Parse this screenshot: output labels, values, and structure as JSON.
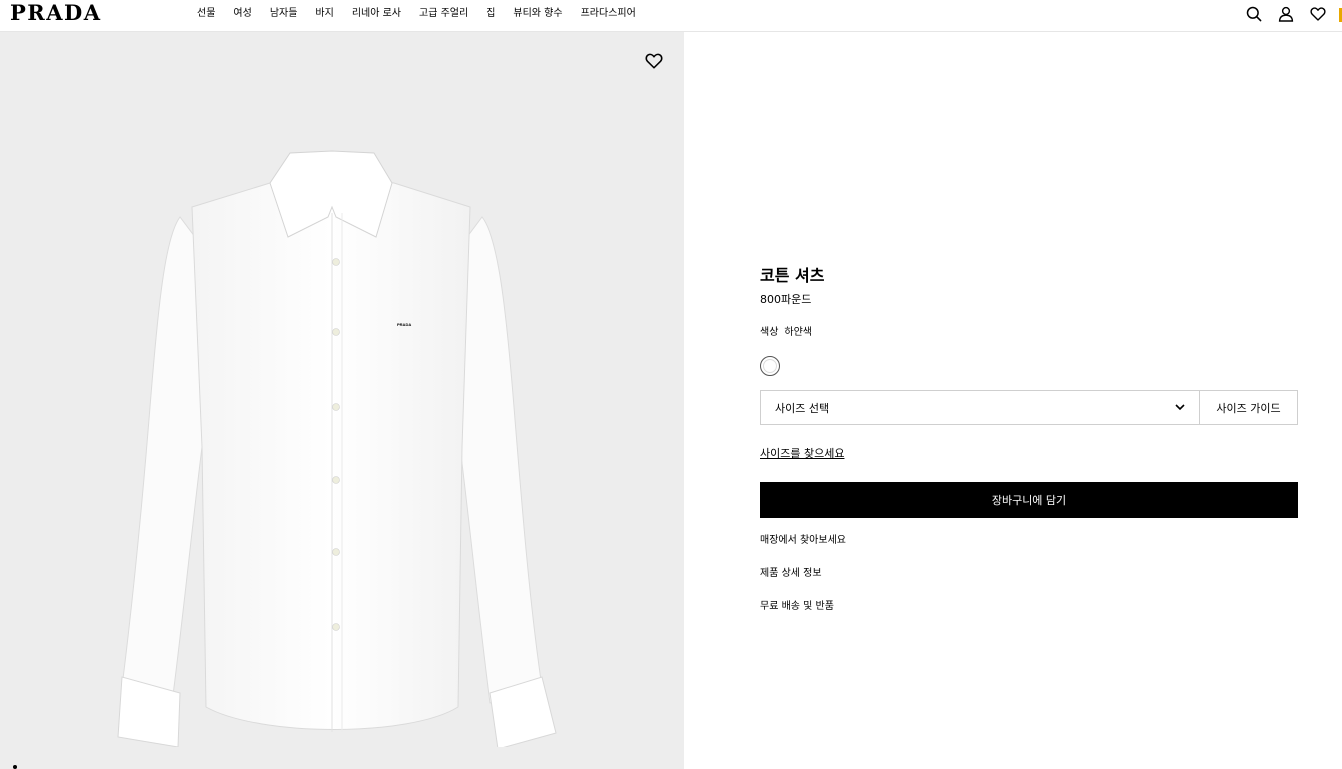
{
  "brand": {
    "logo": "PRADA"
  },
  "nav": {
    "items": [
      "선물",
      "여성",
      "남자들",
      "바지",
      "리네아 로사",
      "고급 주얼리",
      "집",
      "뷰티와 향수",
      "프라다스피어"
    ]
  },
  "header_icons": [
    "search-icon",
    "user-icon",
    "heart-icon"
  ],
  "product": {
    "title": "코튼 셔츠",
    "price": "800파운드",
    "color_label": "색상",
    "color_value": "하얀색",
    "print_text": "PRADA"
  },
  "size": {
    "select_label": "사이즈 선택",
    "guide_label": "사이즈 가이드",
    "find_size": "사이즈를 찾으세요"
  },
  "cart": {
    "label": "장바구니에 담기"
  },
  "links": [
    "매장에서 찾아보세요",
    "제품 상세 정보",
    "무료 배송 및 반품"
  ],
  "colors": {
    "accent": "#e8a800",
    "image_bg": "#ededed",
    "button_bg": "#000000"
  }
}
